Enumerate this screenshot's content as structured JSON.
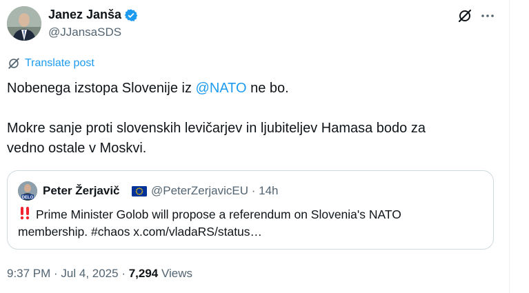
{
  "author": {
    "name": "Janez Janša",
    "handle": "@JJansaSDS",
    "verified_color": "#1d9bf0"
  },
  "actions": {
    "grok_icon": "grok-icon",
    "more_icon": "more-icon"
  },
  "translate": {
    "label": "Translate post"
  },
  "tweet": {
    "line1_before": "Nobenega izstopa Slovenije iz ",
    "mention": "@NATO",
    "line1_after": " ne bo.",
    "line2": "Mokre sanje proti slovenskih levičarjev in ljubiteljev Hamasa bodo za",
    "line3": "vedno ostale v Moskvi."
  },
  "quote": {
    "name": "Peter Žerjavič",
    "handle_time": "@PeterZerjavicEU · 14h",
    "avatar_caption": "DELO",
    "line1": "Prime Minister Golob will propose a referendum on Slovenia's NATO",
    "line2": "membership. #chaos x.com/vladaRS/status…"
  },
  "meta": {
    "timestamp": "9:37 PM · Jul 4, 2025 · ",
    "view_count": "7,294",
    "views_label": " Views"
  },
  "colors": {
    "accent": "#1d9bf0",
    "text": "#0f1419",
    "secondary": "#536471",
    "border": "#cfd9de",
    "alert": "#f4212e"
  }
}
